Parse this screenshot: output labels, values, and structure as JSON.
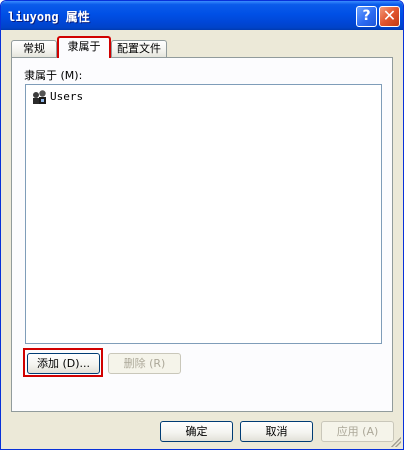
{
  "window": {
    "title": "liuyong 属性",
    "help_label": "?",
    "close_label": "✕"
  },
  "tabs": [
    {
      "label": "常规",
      "selected": false
    },
    {
      "label": "隶属于",
      "selected": true
    },
    {
      "label": "配置文件",
      "selected": false
    }
  ],
  "member_of": {
    "list_label": "隶属于 (M):",
    "items": [
      {
        "label": "Users",
        "icon": "users-group-icon"
      }
    ],
    "add_label": "添加 (D)...",
    "remove_label": "删除 (R)"
  },
  "footer": {
    "ok_label": "确定",
    "cancel_label": "取消",
    "apply_label": "应用 (A)"
  },
  "colors": {
    "titlebar": "#0050E6",
    "highlight": "#D10000",
    "face": "#ECE9D8"
  }
}
